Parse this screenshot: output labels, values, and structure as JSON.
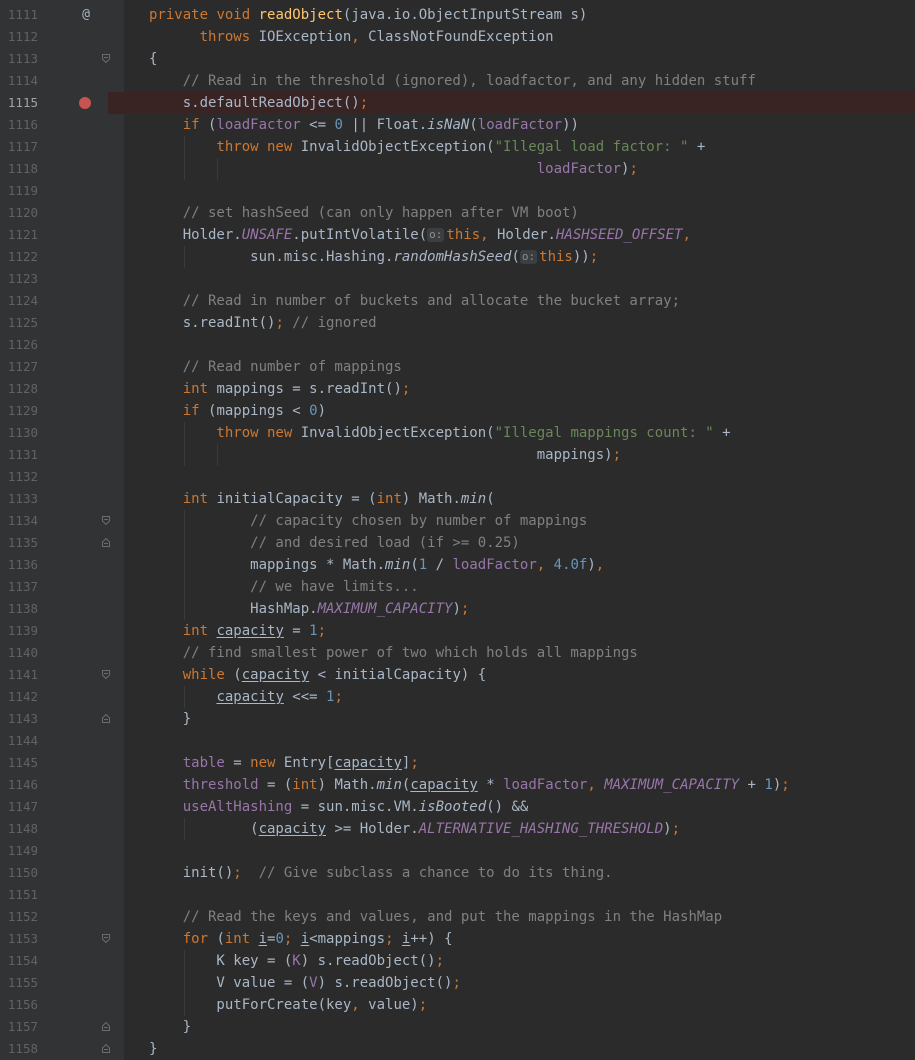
{
  "editor": {
    "method_marker": "@",
    "lines": [
      {
        "n": "1111",
        "marker": "@",
        "fold": "",
        "guides": [],
        "tokens": [
          {
            "t": "private ",
            "c": "kw"
          },
          {
            "t": "void ",
            "c": "kw"
          },
          {
            "t": "readObject",
            "c": "fn"
          },
          {
            "t": "(java.io.ObjectInputStream s)",
            "c": ""
          }
        ]
      },
      {
        "n": "1112",
        "fold": "",
        "guides": [],
        "tokens": [
          {
            "t": "      throws ",
            "c": "kw"
          },
          {
            "t": "IOException",
            "c": ""
          },
          {
            "t": ", ",
            "c": "kw"
          },
          {
            "t": "ClassNotFoundException",
            "c": ""
          }
        ]
      },
      {
        "n": "1113",
        "fold": "open",
        "guides": [],
        "tokens": [
          {
            "t": "{",
            "c": ""
          }
        ]
      },
      {
        "n": "1114",
        "fold": "",
        "guides": [],
        "tokens": [
          {
            "t": "    // Read in the threshold (ignored), loadfactor, and any hidden stuff",
            "c": "cm"
          }
        ]
      },
      {
        "n": "1115",
        "breakpoint": true,
        "current": true,
        "fold": "",
        "guides": [],
        "tokens": [
          {
            "t": "    s.defaultReadObject()",
            "c": ""
          },
          {
            "t": ";",
            "c": "kw"
          }
        ]
      },
      {
        "n": "1116",
        "fold": "",
        "guides": [],
        "tokens": [
          {
            "t": "    if ",
            "c": "kw"
          },
          {
            "t": "(",
            "c": ""
          },
          {
            "t": "loadFactor",
            "c": "fd"
          },
          {
            "t": " <= ",
            "c": ""
          },
          {
            "t": "0",
            "c": "nm"
          },
          {
            "t": " || Float.",
            "c": ""
          },
          {
            "t": "isNaN",
            "c": "it"
          },
          {
            "t": "(",
            "c": ""
          },
          {
            "t": "loadFactor",
            "c": "fd"
          },
          {
            "t": "))",
            "c": ""
          }
        ]
      },
      {
        "n": "1117",
        "fold": "",
        "guides": [
          4
        ],
        "tokens": [
          {
            "t": "        throw new ",
            "c": "kw"
          },
          {
            "t": "InvalidObjectException(",
            "c": ""
          },
          {
            "t": "\"Illegal load factor: \"",
            "c": "st"
          },
          {
            "t": " +",
            "c": ""
          }
        ]
      },
      {
        "n": "1118",
        "fold": "",
        "guides": [
          4,
          8
        ],
        "tokens": [
          {
            "t": "                                              ",
            "c": ""
          },
          {
            "t": "loadFactor",
            "c": "fd"
          },
          {
            "t": ")",
            "c": ""
          },
          {
            "t": ";",
            "c": "kw"
          }
        ]
      },
      {
        "n": "1119",
        "fold": "",
        "guides": [],
        "tokens": []
      },
      {
        "n": "1120",
        "fold": "",
        "guides": [],
        "tokens": [
          {
            "t": "    // set hashSeed (can only happen after VM boot)",
            "c": "cm"
          }
        ]
      },
      {
        "n": "1121",
        "fold": "",
        "guides": [],
        "tokens": [
          {
            "t": "    Holder.",
            "c": ""
          },
          {
            "t": "UNSAFE",
            "c": "sf"
          },
          {
            "t": ".putIntVolatile(",
            "c": ""
          },
          {
            "t": "o:",
            "c": "hint"
          },
          {
            "t": "this",
            "c": "kw"
          },
          {
            "t": ", ",
            "c": "kw"
          },
          {
            "t": "Holder.",
            "c": ""
          },
          {
            "t": "HASHSEED_OFFSET",
            "c": "sf"
          },
          {
            "t": ",",
            "c": "kw"
          }
        ]
      },
      {
        "n": "1122",
        "fold": "",
        "guides": [
          4
        ],
        "tokens": [
          {
            "t": "            sun.misc.Hashing.",
            "c": ""
          },
          {
            "t": "randomHashSeed",
            "c": "it"
          },
          {
            "t": "(",
            "c": ""
          },
          {
            "t": "o:",
            "c": "hint"
          },
          {
            "t": "this",
            "c": "kw"
          },
          {
            "t": "))",
            "c": ""
          },
          {
            "t": ";",
            "c": "kw"
          }
        ]
      },
      {
        "n": "1123",
        "fold": "",
        "guides": [],
        "tokens": []
      },
      {
        "n": "1124",
        "fold": "",
        "guides": [],
        "tokens": [
          {
            "t": "    // Read in number of buckets and allocate the bucket array;",
            "c": "cm"
          }
        ]
      },
      {
        "n": "1125",
        "fold": "",
        "guides": [],
        "tokens": [
          {
            "t": "    s.readInt()",
            "c": ""
          },
          {
            "t": "; ",
            "c": "kw"
          },
          {
            "t": "// ignored",
            "c": "cm"
          }
        ]
      },
      {
        "n": "1126",
        "fold": "",
        "guides": [],
        "tokens": []
      },
      {
        "n": "1127",
        "fold": "",
        "guides": [],
        "tokens": [
          {
            "t": "    // Read number of mappings",
            "c": "cm"
          }
        ]
      },
      {
        "n": "1128",
        "fold": "",
        "guides": [],
        "tokens": [
          {
            "t": "    int ",
            "c": "kw"
          },
          {
            "t": "mappings = s.readInt()",
            "c": ""
          },
          {
            "t": ";",
            "c": "kw"
          }
        ]
      },
      {
        "n": "1129",
        "fold": "",
        "guides": [],
        "tokens": [
          {
            "t": "    if ",
            "c": "kw"
          },
          {
            "t": "(mappings < ",
            "c": ""
          },
          {
            "t": "0",
            "c": "nm"
          },
          {
            "t": ")",
            "c": ""
          }
        ]
      },
      {
        "n": "1130",
        "fold": "",
        "guides": [
          4
        ],
        "tokens": [
          {
            "t": "        throw new ",
            "c": "kw"
          },
          {
            "t": "InvalidObjectException(",
            "c": ""
          },
          {
            "t": "\"Illegal mappings count: \"",
            "c": "st"
          },
          {
            "t": " +",
            "c": ""
          }
        ]
      },
      {
        "n": "1131",
        "fold": "",
        "guides": [
          4,
          8
        ],
        "tokens": [
          {
            "t": "                                              mappings)",
            "c": ""
          },
          {
            "t": ";",
            "c": "kw"
          }
        ]
      },
      {
        "n": "1132",
        "fold": "",
        "guides": [],
        "tokens": []
      },
      {
        "n": "1133",
        "fold": "",
        "guides": [],
        "tokens": [
          {
            "t": "    int ",
            "c": "kw"
          },
          {
            "t": "initialCapacity = (",
            "c": ""
          },
          {
            "t": "int",
            "c": "kw"
          },
          {
            "t": ") Math.",
            "c": ""
          },
          {
            "t": "min",
            "c": "it"
          },
          {
            "t": "(",
            "c": ""
          }
        ]
      },
      {
        "n": "1134",
        "fold": "open",
        "guides": [
          4
        ],
        "tokens": [
          {
            "t": "            // capacity chosen by number of mappings",
            "c": "cm"
          }
        ]
      },
      {
        "n": "1135",
        "fold": "close",
        "guides": [
          4
        ],
        "tokens": [
          {
            "t": "            // and desired load (if >= 0.25)",
            "c": "cm"
          }
        ]
      },
      {
        "n": "1136",
        "fold": "",
        "guides": [
          4
        ],
        "tokens": [
          {
            "t": "            mappings * Math.",
            "c": ""
          },
          {
            "t": "min",
            "c": "it"
          },
          {
            "t": "(",
            "c": ""
          },
          {
            "t": "1",
            "c": "nm"
          },
          {
            "t": " / ",
            "c": ""
          },
          {
            "t": "loadFactor",
            "c": "fd"
          },
          {
            "t": ", ",
            "c": "kw"
          },
          {
            "t": "4.0f",
            "c": "nm"
          },
          {
            "t": ")",
            "c": ""
          },
          {
            "t": ",",
            "c": "kw"
          }
        ]
      },
      {
        "n": "1137",
        "fold": "",
        "guides": [
          4
        ],
        "tokens": [
          {
            "t": "            // we have limits...",
            "c": "cm"
          }
        ]
      },
      {
        "n": "1138",
        "fold": "",
        "guides": [
          4
        ],
        "tokens": [
          {
            "t": "            HashMap.",
            "c": ""
          },
          {
            "t": "MAXIMUM_CAPACITY",
            "c": "sf"
          },
          {
            "t": ")",
            "c": ""
          },
          {
            "t": ";",
            "c": "kw"
          }
        ]
      },
      {
        "n": "1139",
        "fold": "",
        "guides": [],
        "tokens": [
          {
            "t": "    int ",
            "c": "kw"
          },
          {
            "t": "capacity",
            "c": "ul"
          },
          {
            "t": " = ",
            "c": ""
          },
          {
            "t": "1",
            "c": "nm"
          },
          {
            "t": ";",
            "c": "kw"
          }
        ]
      },
      {
        "n": "1140",
        "fold": "",
        "guides": [],
        "tokens": [
          {
            "t": "    // find smallest power of two which holds all mappings",
            "c": "cm"
          }
        ]
      },
      {
        "n": "1141",
        "fold": "open",
        "guides": [],
        "tokens": [
          {
            "t": "    while ",
            "c": "kw"
          },
          {
            "t": "(",
            "c": ""
          },
          {
            "t": "capacity",
            "c": "ul"
          },
          {
            "t": " < initialCapacity) {",
            "c": ""
          }
        ]
      },
      {
        "n": "1142",
        "fold": "",
        "guides": [
          4
        ],
        "tokens": [
          {
            "t": "        ",
            "c": ""
          },
          {
            "t": "capacity",
            "c": "ul"
          },
          {
            "t": " <<= ",
            "c": ""
          },
          {
            "t": "1",
            "c": "nm"
          },
          {
            "t": ";",
            "c": "kw"
          }
        ]
      },
      {
        "n": "1143",
        "fold": "close",
        "guides": [],
        "tokens": [
          {
            "t": "    }",
            "c": ""
          }
        ]
      },
      {
        "n": "1144",
        "fold": "",
        "guides": [],
        "tokens": []
      },
      {
        "n": "1145",
        "fold": "",
        "guides": [],
        "tokens": [
          {
            "t": "    ",
            "c": ""
          },
          {
            "t": "table",
            "c": "fd"
          },
          {
            "t": " = ",
            "c": ""
          },
          {
            "t": "new ",
            "c": "kw"
          },
          {
            "t": "Entry[",
            "c": ""
          },
          {
            "t": "capacity",
            "c": "ul"
          },
          {
            "t": "]",
            "c": ""
          },
          {
            "t": ";",
            "c": "kw"
          }
        ]
      },
      {
        "n": "1146",
        "fold": "",
        "guides": [],
        "tokens": [
          {
            "t": "    ",
            "c": ""
          },
          {
            "t": "threshold",
            "c": "fd"
          },
          {
            "t": " = (",
            "c": ""
          },
          {
            "t": "int",
            "c": "kw"
          },
          {
            "t": ") Math.",
            "c": ""
          },
          {
            "t": "min",
            "c": "it"
          },
          {
            "t": "(",
            "c": ""
          },
          {
            "t": "capacity",
            "c": "ul"
          },
          {
            "t": " * ",
            "c": ""
          },
          {
            "t": "loadFactor",
            "c": "fd"
          },
          {
            "t": ", ",
            "c": "kw"
          },
          {
            "t": "MAXIMUM_CAPACITY",
            "c": "sf"
          },
          {
            "t": " + ",
            "c": ""
          },
          {
            "t": "1",
            "c": "nm"
          },
          {
            "t": ")",
            "c": ""
          },
          {
            "t": ";",
            "c": "kw"
          }
        ]
      },
      {
        "n": "1147",
        "fold": "",
        "guides": [],
        "tokens": [
          {
            "t": "    ",
            "c": ""
          },
          {
            "t": "useAltHashing",
            "c": "fd"
          },
          {
            "t": " = sun.misc.VM.",
            "c": ""
          },
          {
            "t": "isBooted",
            "c": "it"
          },
          {
            "t": "() &&",
            "c": ""
          }
        ]
      },
      {
        "n": "1148",
        "fold": "",
        "guides": [
          4
        ],
        "tokens": [
          {
            "t": "            (",
            "c": ""
          },
          {
            "t": "capacity",
            "c": "ul"
          },
          {
            "t": " >= Holder.",
            "c": ""
          },
          {
            "t": "ALTERNATIVE_HASHING_THRESHOLD",
            "c": "sf"
          },
          {
            "t": ")",
            "c": ""
          },
          {
            "t": ";",
            "c": "kw"
          }
        ]
      },
      {
        "n": "1149",
        "fold": "",
        "guides": [],
        "tokens": []
      },
      {
        "n": "1150",
        "fold": "",
        "guides": [],
        "tokens": [
          {
            "t": "    init()",
            "c": ""
          },
          {
            "t": ";  ",
            "c": "kw"
          },
          {
            "t": "// Give subclass a chance to do its thing.",
            "c": "cm"
          }
        ]
      },
      {
        "n": "1151",
        "fold": "",
        "guides": [],
        "tokens": []
      },
      {
        "n": "1152",
        "fold": "",
        "guides": [],
        "tokens": [
          {
            "t": "    // Read the keys and values, and put the mappings in the HashMap",
            "c": "cm"
          }
        ]
      },
      {
        "n": "1153",
        "fold": "open",
        "guides": [],
        "tokens": [
          {
            "t": "    for ",
            "c": "kw"
          },
          {
            "t": "(",
            "c": ""
          },
          {
            "t": "int ",
            "c": "kw"
          },
          {
            "t": "i",
            "c": "ul"
          },
          {
            "t": "=",
            "c": ""
          },
          {
            "t": "0",
            "c": "nm"
          },
          {
            "t": "; ",
            "c": "kw"
          },
          {
            "t": "i",
            "c": "ul"
          },
          {
            "t": "<mappings",
            "c": ""
          },
          {
            "t": "; ",
            "c": "kw"
          },
          {
            "t": "i",
            "c": "ul"
          },
          {
            "t": "++) {",
            "c": ""
          }
        ]
      },
      {
        "n": "1154",
        "fold": "",
        "guides": [
          4
        ],
        "tokens": [
          {
            "t": "        K key = (",
            "c": ""
          },
          {
            "t": "K",
            "c": "fd"
          },
          {
            "t": ") s.readObject()",
            "c": ""
          },
          {
            "t": ";",
            "c": "kw"
          }
        ]
      },
      {
        "n": "1155",
        "fold": "",
        "guides": [
          4
        ],
        "tokens": [
          {
            "t": "        V value = (",
            "c": ""
          },
          {
            "t": "V",
            "c": "fd"
          },
          {
            "t": ") s.readObject()",
            "c": ""
          },
          {
            "t": ";",
            "c": "kw"
          }
        ]
      },
      {
        "n": "1156",
        "fold": "",
        "guides": [
          4
        ],
        "tokens": [
          {
            "t": "        putForCreate(key",
            "c": ""
          },
          {
            "t": ", ",
            "c": "kw"
          },
          {
            "t": "value)",
            "c": ""
          },
          {
            "t": ";",
            "c": "kw"
          }
        ]
      },
      {
        "n": "1157",
        "fold": "close",
        "guides": [],
        "tokens": [
          {
            "t": "    }",
            "c": ""
          }
        ]
      },
      {
        "n": "1158",
        "fold": "close",
        "guides": [],
        "tokens": [
          {
            "t": "}",
            "c": ""
          }
        ]
      }
    ]
  },
  "colors": {
    "background": "#2b2b2b",
    "gutter": "#313335",
    "keyword": "#cc7832",
    "method": "#ffc66d",
    "comment": "#808080",
    "string": "#6a8759",
    "number": "#6897bb",
    "field": "#9876aa",
    "breakpoint": "#c75450",
    "breakpoint_line": "#3a2323"
  }
}
